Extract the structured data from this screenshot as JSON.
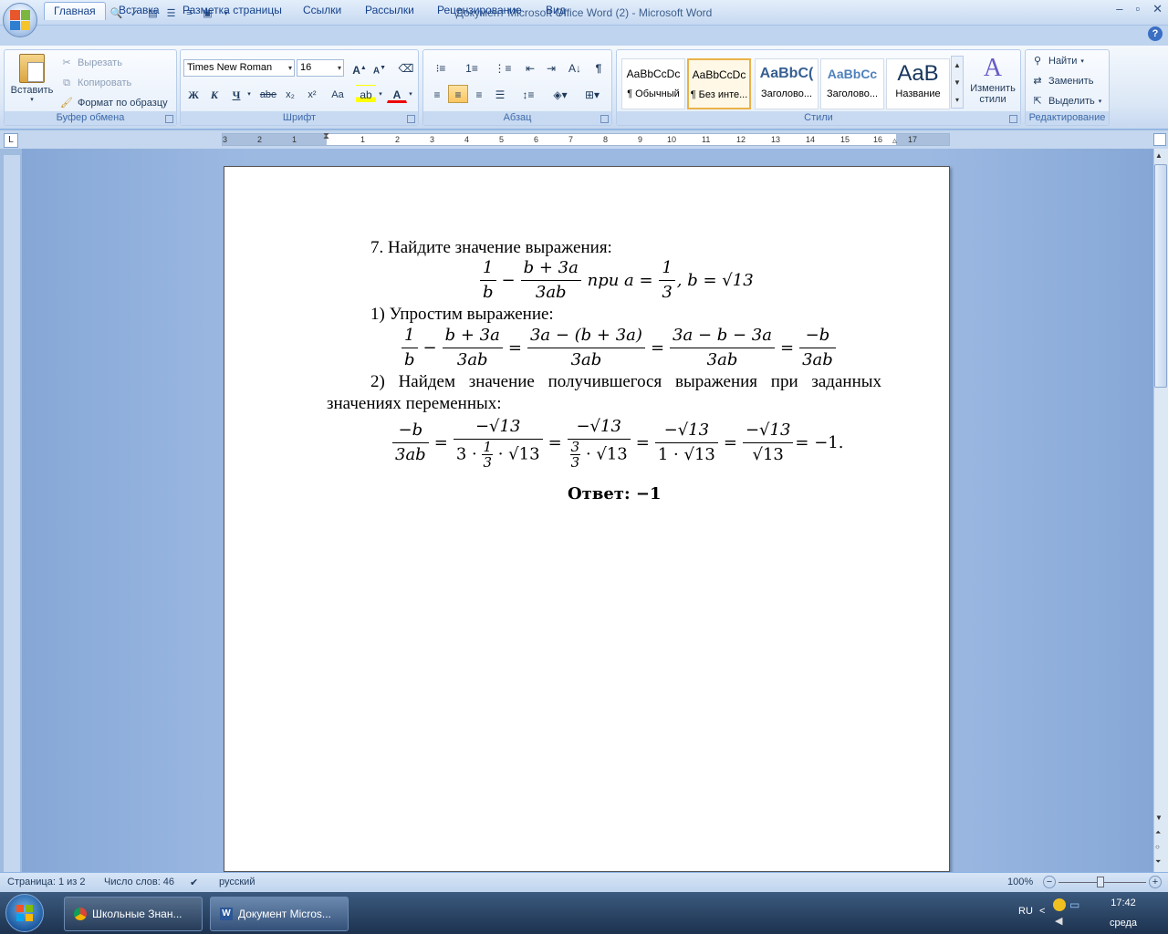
{
  "window": {
    "title": "Документ Microsoft Office Word (2) - Microsoft Word",
    "controls": [
      "–",
      "▫",
      "✕"
    ]
  },
  "ribbon_tabs": [
    "Главная",
    "Вставка",
    "Разметка страницы",
    "Ссылки",
    "Рассылки",
    "Рецензирование",
    "Вид"
  ],
  "clipboard": {
    "paste": "Вставить",
    "cut": "Вырезать",
    "copy": "Копировать",
    "format_painter": "Формат по образцу",
    "label": "Буфер обмена"
  },
  "font": {
    "family": "Times New Roman",
    "size": "16",
    "label": "Шрифт",
    "bold": "Ж",
    "italic": "К",
    "underline": "Ч",
    "strike": "abe",
    "subscript": "x₂",
    "superscript": "x²",
    "case": "Aa"
  },
  "paragraph": {
    "label": "Абзац"
  },
  "styles": {
    "label": "Стили",
    "items": [
      {
        "sample": "AaBbCcDc",
        "name": "¶ Обычный"
      },
      {
        "sample": "AaBbCcDc",
        "name": "¶ Без инте..."
      },
      {
        "sample": "AaBbC(",
        "name": "Заголово..."
      },
      {
        "sample": "AaBbCc",
        "name": "Заголово..."
      },
      {
        "sample": "AaB",
        "name": "Название"
      }
    ],
    "change": "Изменить стили"
  },
  "editing": {
    "find": "Найти",
    "replace": "Заменить",
    "select": "Выделить",
    "label": "Редактирование"
  },
  "ruler": {
    "numbers": [
      "3",
      "2",
      "1",
      "1",
      "2",
      "3",
      "4",
      "5",
      "6",
      "7",
      "8",
      "9",
      "10",
      "11",
      "12",
      "13",
      "14",
      "15",
      "16",
      "17"
    ]
  },
  "document": {
    "task": "7. Найдите значение выражения:",
    "expr": {
      "f1_num": "1",
      "f1_den": "b",
      "minus": "−",
      "f2_num": "b + 3a",
      "f2_den": "3ab",
      "pri": "при a =",
      "f3_num": "1",
      "f3_den": "3",
      "b_eq": ", b = √13"
    },
    "step1": "1) Упростим выражение:",
    "step1_expr": {
      "a_num": "1",
      "a_den": "b",
      "minus": "−",
      "b_num": "b + 3a",
      "b_den": "3ab",
      "eq": "=",
      "c_num": "3a − (b + 3a)",
      "c_den": "3ab",
      "d_num": "3a − b − 3a",
      "d_den": "3ab",
      "e_num": "−b",
      "e_den": "3ab"
    },
    "step2_line1": "2) Найдем значение получившегося выражения при заданных",
    "step2_line2": "значениях переменных:",
    "step2_expr": {
      "a_num": "−b",
      "a_den": "3ab",
      "eq": "=",
      "b_num": "−√13",
      "b_den_pre": "3 ·",
      "b_den_fnum": "1",
      "b_den_fden": "3",
      "b_den_post": "· √13",
      "c_num": "−√13",
      "c_den_fnum": "3",
      "c_den_fden": "3",
      "c_den_post": "· √13",
      "d_num": "−√13",
      "d_den": "1 · √13",
      "e_num": "−√13",
      "e_den": "√13",
      "result": "= −1."
    },
    "answer": "Ответ: −1"
  },
  "status": {
    "page": "Страница: 1 из 2",
    "words": "Число слов: 46",
    "language": "русский",
    "zoom": "100%"
  },
  "taskbar": {
    "items": [
      "Школьные Знан...",
      "Документ Micros..."
    ],
    "lang": "RU",
    "time": "17:42",
    "day": "среда"
  }
}
